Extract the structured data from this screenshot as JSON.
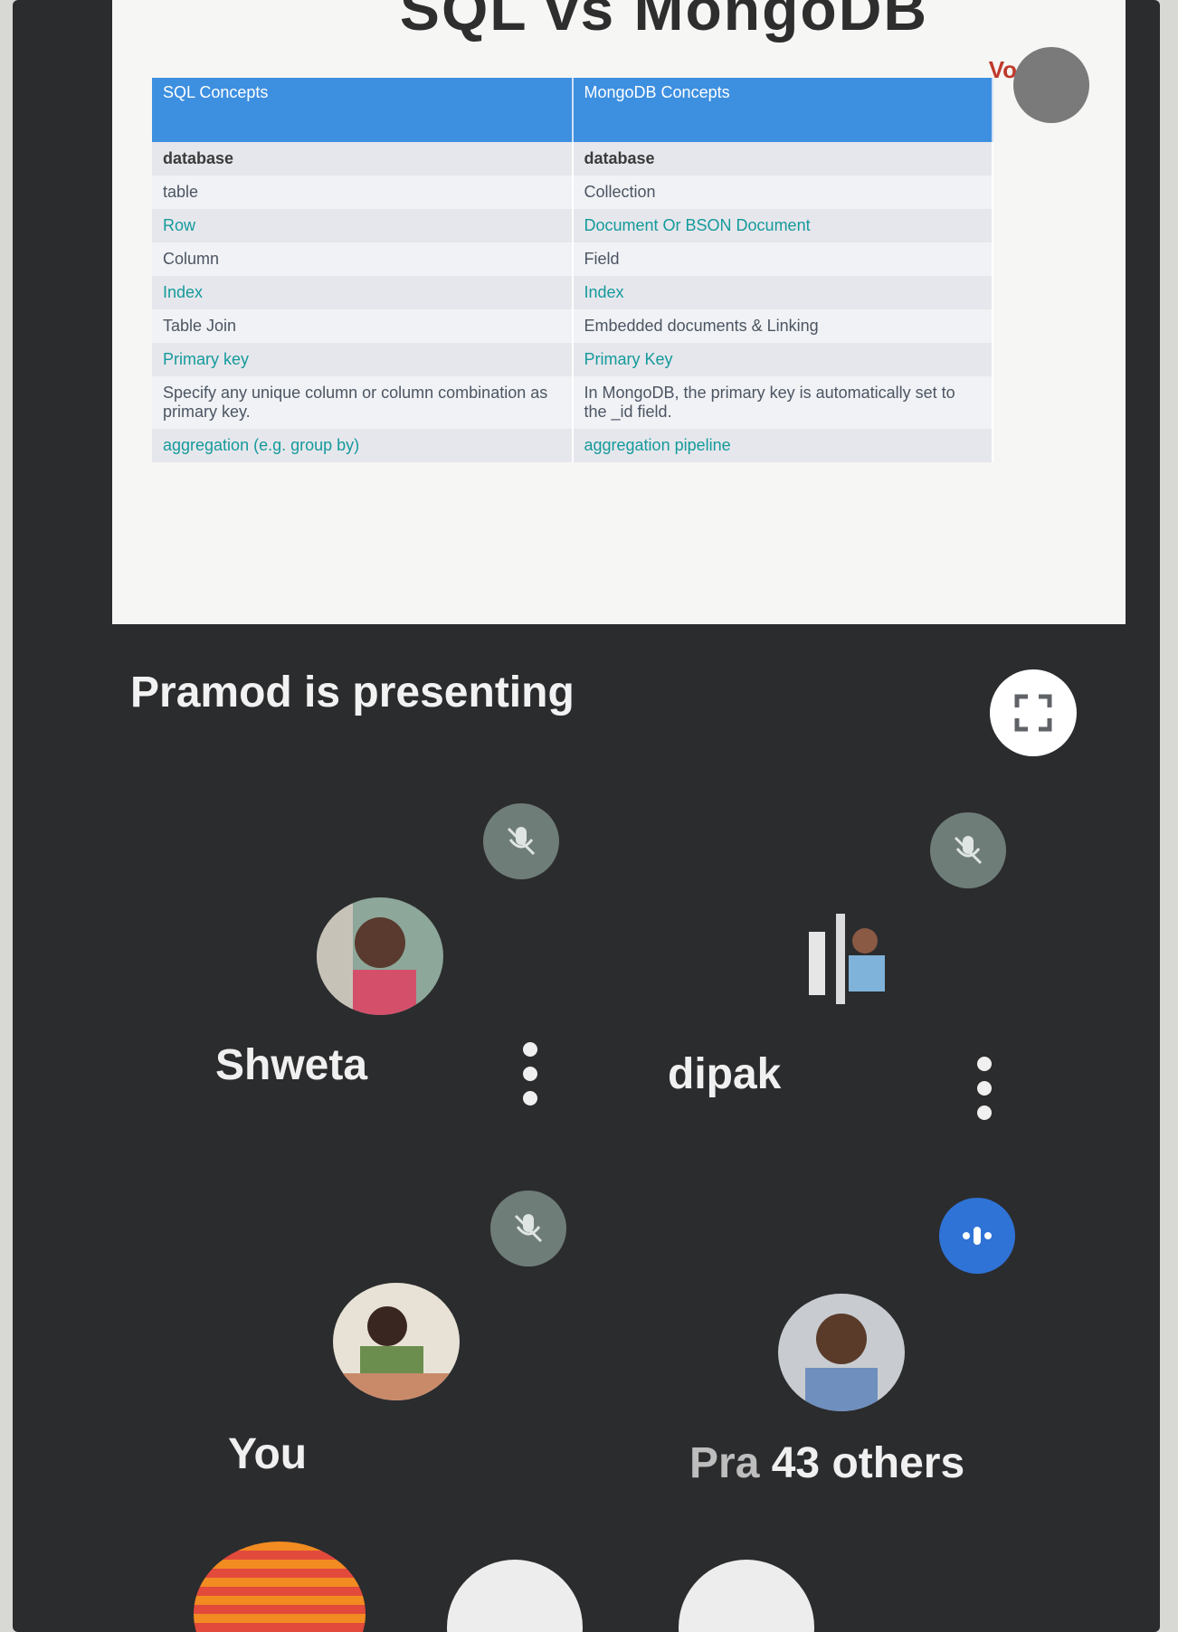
{
  "slide": {
    "heading": "SQL vs MongoDB",
    "logo_text": "Vo",
    "columns": [
      "SQL Concepts",
      "MongoDB Concepts"
    ],
    "rows": [
      [
        "database",
        "database"
      ],
      [
        "table",
        "Collection"
      ],
      [
        "Row",
        "Document Or BSON Document"
      ],
      [
        "Column",
        "Field"
      ],
      [
        "Index",
        "Index"
      ],
      [
        "Table Join",
        "Embedded documents & Linking"
      ],
      [
        "Primary key",
        "Primary Key"
      ],
      [
        "Specify any unique column or column combination as primary key.",
        "In MongoDB, the primary key is automatically set to the _id field."
      ],
      [
        "aggregation (e.g. group by)",
        "aggregation pipeline"
      ]
    ]
  },
  "presenter_banner": "Pramod is presenting",
  "participants": [
    {
      "name": "Shweta",
      "mic": "muted-mic-icon"
    },
    {
      "name": "dipak",
      "mic": "muted-mic-icon"
    },
    {
      "name": "You",
      "mic": "muted-mic-icon"
    },
    {
      "name": "Pra",
      "mic": "speaking-icon"
    }
  ],
  "others_label": "43 others",
  "colors": {
    "background": "#2b2c2e",
    "table_header": "#3d8fe0",
    "muted_badge": "#6f7d78",
    "speaking_badge": "#2f73d6"
  }
}
